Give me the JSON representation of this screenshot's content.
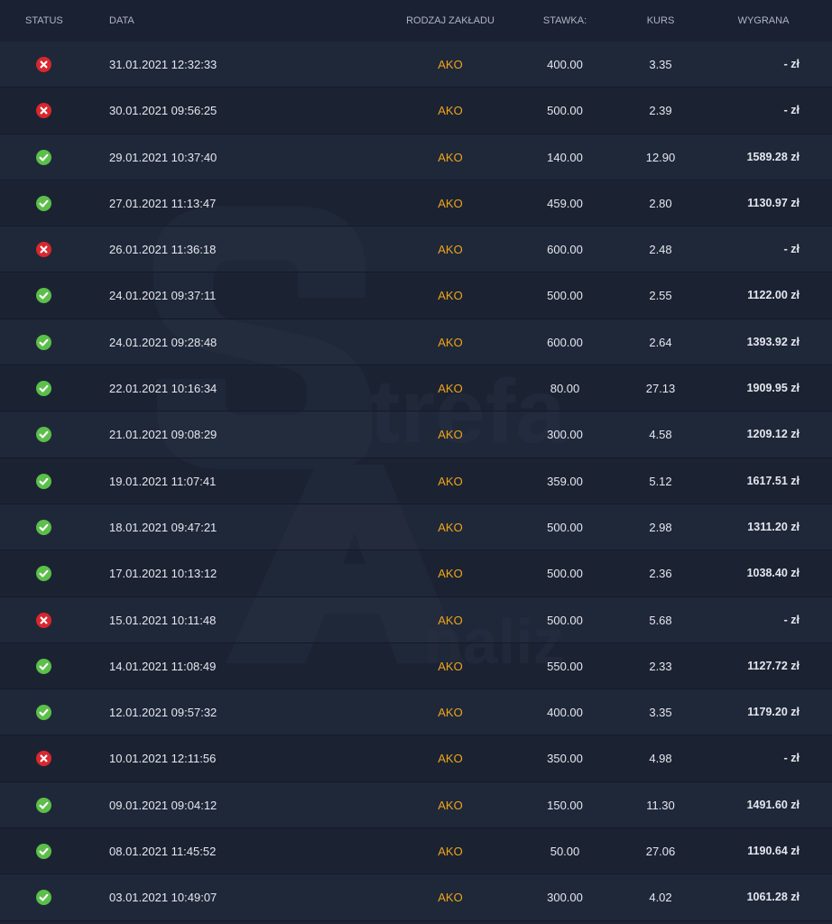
{
  "colors": {
    "win": "#5bbf4a",
    "loss": "#d9272e",
    "accent": "#f0a418"
  },
  "header": {
    "status": "STATUS",
    "date": "DATA",
    "type": "RODZAJ ZAKŁADU",
    "stake": "STAWKA:",
    "odds": "KURS",
    "win": "WYGRANA"
  },
  "watermark": {
    "word1": "trefa",
    "word2": "naliz"
  },
  "rows": [
    {
      "status": "loss",
      "date": "31.01.2021 12:32:33",
      "type": "AKO",
      "stake": "400.00",
      "odds": "3.35",
      "win": "- zł"
    },
    {
      "status": "loss",
      "date": "30.01.2021 09:56:25",
      "type": "AKO",
      "stake": "500.00",
      "odds": "2.39",
      "win": "- zł"
    },
    {
      "status": "win",
      "date": "29.01.2021 10:37:40",
      "type": "AKO",
      "stake": "140.00",
      "odds": "12.90",
      "win": "1589.28 zł"
    },
    {
      "status": "win",
      "date": "27.01.2021 11:13:47",
      "type": "AKO",
      "stake": "459.00",
      "odds": "2.80",
      "win": "1130.97 zł"
    },
    {
      "status": "loss",
      "date": "26.01.2021 11:36:18",
      "type": "AKO",
      "stake": "600.00",
      "odds": "2.48",
      "win": "- zł"
    },
    {
      "status": "win",
      "date": "24.01.2021 09:37:11",
      "type": "AKO",
      "stake": "500.00",
      "odds": "2.55",
      "win": "1122.00 zł"
    },
    {
      "status": "win",
      "date": "24.01.2021 09:28:48",
      "type": "AKO",
      "stake": "600.00",
      "odds": "2.64",
      "win": "1393.92 zł"
    },
    {
      "status": "win",
      "date": "22.01.2021 10:16:34",
      "type": "AKO",
      "stake": "80.00",
      "odds": "27.13",
      "win": "1909.95 zł"
    },
    {
      "status": "win",
      "date": "21.01.2021 09:08:29",
      "type": "AKO",
      "stake": "300.00",
      "odds": "4.58",
      "win": "1209.12 zł"
    },
    {
      "status": "win",
      "date": "19.01.2021 11:07:41",
      "type": "AKO",
      "stake": "359.00",
      "odds": "5.12",
      "win": "1617.51 zł"
    },
    {
      "status": "win",
      "date": "18.01.2021 09:47:21",
      "type": "AKO",
      "stake": "500.00",
      "odds": "2.98",
      "win": "1311.20 zł"
    },
    {
      "status": "win",
      "date": "17.01.2021 10:13:12",
      "type": "AKO",
      "stake": "500.00",
      "odds": "2.36",
      "win": "1038.40 zł"
    },
    {
      "status": "loss",
      "date": "15.01.2021 10:11:48",
      "type": "AKO",
      "stake": "500.00",
      "odds": "5.68",
      "win": "- zł"
    },
    {
      "status": "win",
      "date": "14.01.2021 11:08:49",
      "type": "AKO",
      "stake": "550.00",
      "odds": "2.33",
      "win": "1127.72 zł"
    },
    {
      "status": "win",
      "date": "12.01.2021 09:57:32",
      "type": "AKO",
      "stake": "400.00",
      "odds": "3.35",
      "win": "1179.20 zł"
    },
    {
      "status": "loss",
      "date": "10.01.2021 12:11:56",
      "type": "AKO",
      "stake": "350.00",
      "odds": "4.98",
      "win": "- zł"
    },
    {
      "status": "win",
      "date": "09.01.2021 09:04:12",
      "type": "AKO",
      "stake": "150.00",
      "odds": "11.30",
      "win": "1491.60 zł"
    },
    {
      "status": "win",
      "date": "08.01.2021 11:45:52",
      "type": "AKO",
      "stake": "50.00",
      "odds": "27.06",
      "win": "1190.64 zł"
    },
    {
      "status": "win",
      "date": "03.01.2021 10:49:07",
      "type": "AKO",
      "stake": "300.00",
      "odds": "4.02",
      "win": "1061.28 zł"
    }
  ]
}
